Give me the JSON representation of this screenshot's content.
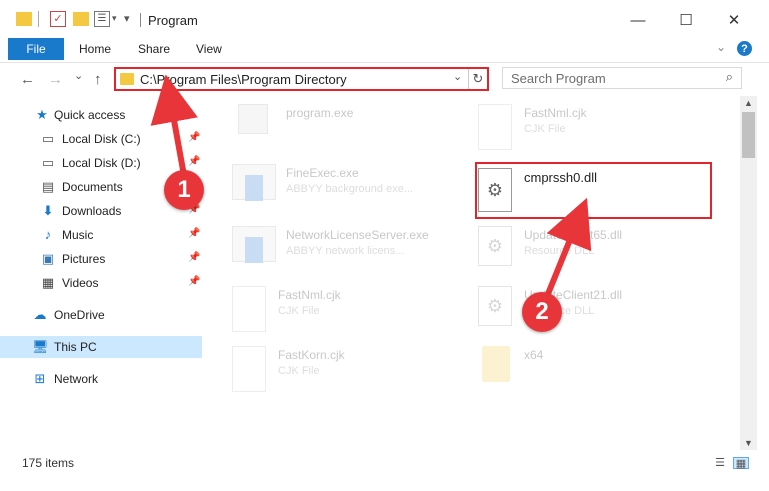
{
  "window": {
    "title": "Program",
    "minimize_glyph": "—",
    "maximize_glyph": "☐",
    "close_glyph": "✕"
  },
  "ribbon": {
    "tabs": [
      {
        "label": "File"
      },
      {
        "label": "Home"
      },
      {
        "label": "Share"
      },
      {
        "label": "View"
      }
    ],
    "help_glyph": "?"
  },
  "navigation": {
    "back_glyph": "←",
    "forward_glyph": "→",
    "recent_glyph": "⌄",
    "up_glyph": "↑",
    "address": "C:\\Program Files\\Program Directory",
    "dropdown_glyph": "⌄",
    "refresh_glyph": "↻",
    "search_placeholder": "Search Program",
    "search_glyph": "⌕"
  },
  "sidebar": {
    "items": [
      {
        "label": "Quick access",
        "icon": "star-icon"
      },
      {
        "label": "Local Disk (C:)",
        "icon": "drive-icon",
        "pinned": true
      },
      {
        "label": "Local Disk (D:)",
        "icon": "drive-icon",
        "pinned": true
      },
      {
        "label": "Documents",
        "icon": "documents-icon",
        "pinned": true
      },
      {
        "label": "Downloads",
        "icon": "download-icon",
        "pinned": true
      },
      {
        "label": "Music",
        "icon": "music-icon",
        "pinned": true
      },
      {
        "label": "Pictures",
        "icon": "pictures-icon",
        "pinned": true
      },
      {
        "label": "Videos",
        "icon": "videos-icon",
        "pinned": true
      },
      {
        "label": "OneDrive",
        "icon": "cloud-icon"
      },
      {
        "label": "This PC",
        "icon": "computer-icon",
        "selected": true
      },
      {
        "label": "Network",
        "icon": "network-icon"
      }
    ]
  },
  "files": [
    {
      "name": "program.exe",
      "type": "",
      "icon": "exe-icon"
    },
    {
      "name": "FastNml.cjk",
      "type": "CJK File",
      "icon": "document-icon"
    },
    {
      "name": "FineExec.exe",
      "type": "ABBYY background exe...",
      "icon": "app-icon"
    },
    {
      "name": "cmprssh0.dll",
      "type": "",
      "icon": "dll-icon"
    },
    {
      "name": "NetworkLicenseServer.exe",
      "type": "ABBYY network licens...",
      "icon": "app-icon"
    },
    {
      "name": "UpdateClient65.dll",
      "type": "Resource DLL",
      "icon": "dll-icon"
    },
    {
      "name": "FastNml.cjk",
      "type": "CJK File",
      "icon": "document-icon"
    },
    {
      "name": "UpdateClient21.dll",
      "type": "Resource DLL",
      "icon": "dll-icon"
    },
    {
      "name": "FastKorn.cjk",
      "type": "CJK File",
      "icon": "document-icon"
    },
    {
      "name": "x64",
      "type": "",
      "icon": "folder-icon"
    }
  ],
  "status": {
    "item_count": "175 items"
  },
  "annotations": [
    {
      "number": "1"
    },
    {
      "number": "2"
    }
  ],
  "colors": {
    "accent": "#1979ca",
    "highlight": "#e0262c",
    "selection": "#cce8ff",
    "annotation": "#e8353a"
  }
}
